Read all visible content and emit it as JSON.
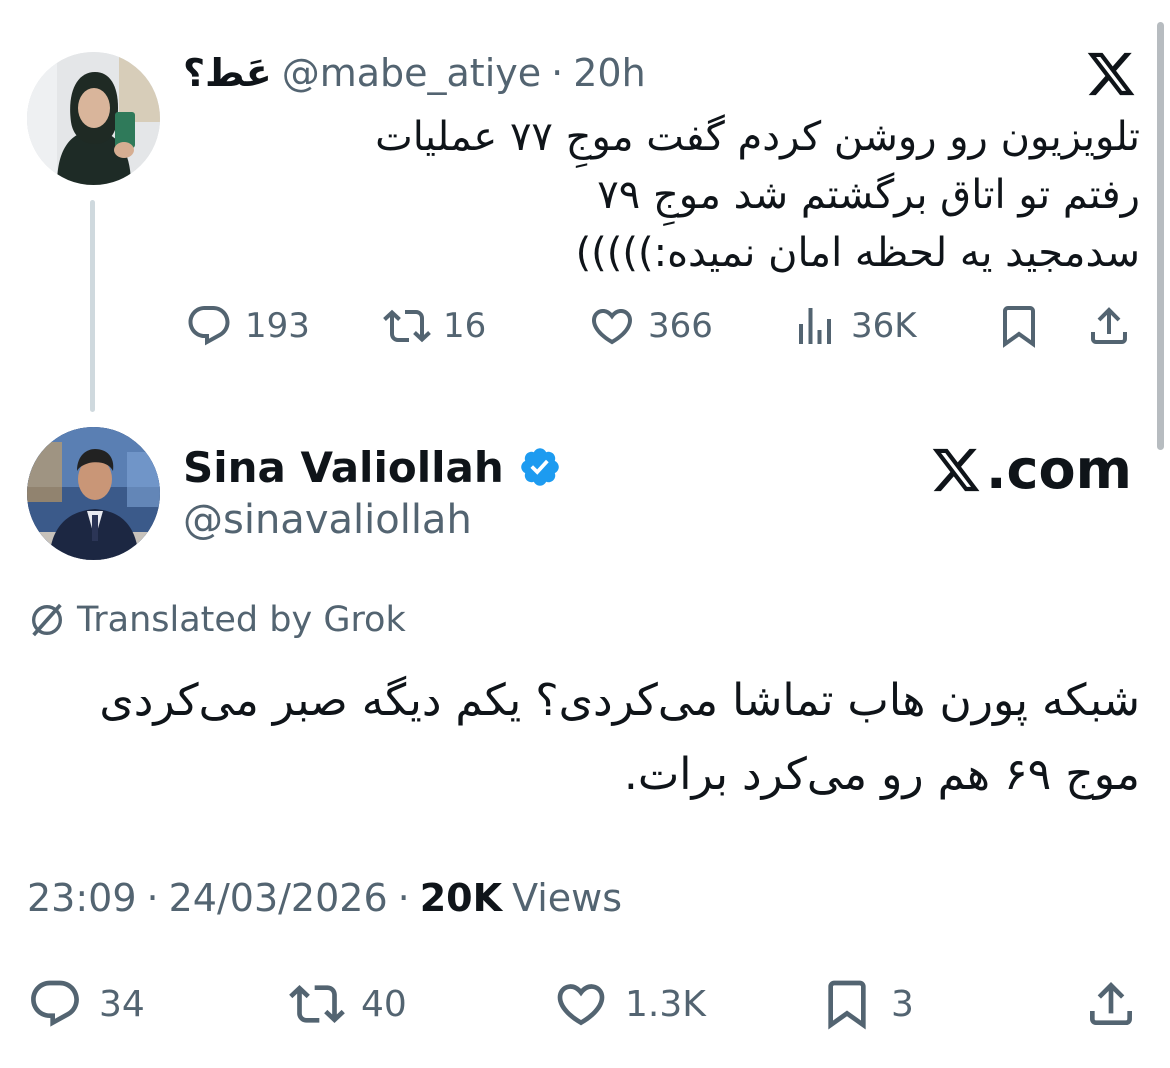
{
  "parent_tweet": {
    "display_name": "عَط؟",
    "handle": "@mabe_atiye",
    "separator": "·",
    "time": "20h",
    "text_lines": [
      "تلویزیون رو روشن کردم گفت موجِ ۷۷ عملیات",
      "رفتم تو اتاق برگشتم شد موجِ ۷۹",
      "سدمجید یه لحظه امان نمیده:)))))"
    ],
    "actions": {
      "replies": "193",
      "reposts": "16",
      "likes": "366",
      "views": "36K"
    },
    "icons": {
      "platform_logo": "x-logo-icon",
      "reply": "reply-icon",
      "repost": "repost-icon",
      "like": "heart-icon",
      "views": "analytics-icon",
      "bookmark": "bookmark-icon",
      "share": "share-icon"
    }
  },
  "main_tweet": {
    "display_name": "Sina Valiollah",
    "handle": "@sinavaliollah",
    "verified": true,
    "watermark": ".com",
    "translated_label": "Translated by Grok",
    "text_lines": [
      "شبکه پورن هاب تماشا می‌کردی؟ یکم دیگه صبر می‌کردی",
      "موج ۶۹ هم رو می‌کرد برات."
    ],
    "time": "23:09",
    "date": "24/03/2026",
    "separator": "·",
    "views_count": "20K",
    "views_label": "Views",
    "actions": {
      "replies": "34",
      "reposts": "40",
      "likes": "1.3K",
      "bookmarks": "3"
    },
    "colors": {
      "verified_badge": "#1d9bf0",
      "secondary_text": "#536471",
      "primary_text": "#0f1419",
      "thread_line": "#cfd9de"
    }
  }
}
